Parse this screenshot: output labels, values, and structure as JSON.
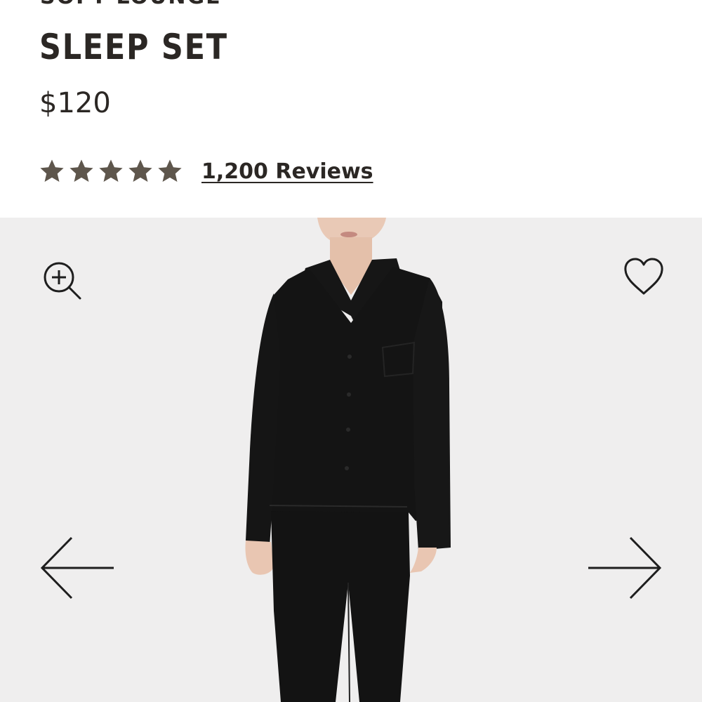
{
  "product": {
    "collection": "SOFT LOUNGE",
    "title": "SLEEP SET",
    "price": "$120",
    "rating": {
      "stars": 5,
      "max_stars": 5,
      "reviews_label": "1,200 Reviews"
    }
  },
  "gallery": {
    "image_alt": "Model wearing black long-sleeve button-up sleep shirt and matching wide-leg pants",
    "icons": {
      "zoom": "zoom-in-icon",
      "wishlist": "heart-icon",
      "previous": "arrow-left-icon",
      "next": "arrow-right-icon"
    }
  },
  "colors": {
    "text": "#2b2724",
    "star": "#5e564c",
    "gallery_background": "#efeeee",
    "garment": "#141414"
  }
}
